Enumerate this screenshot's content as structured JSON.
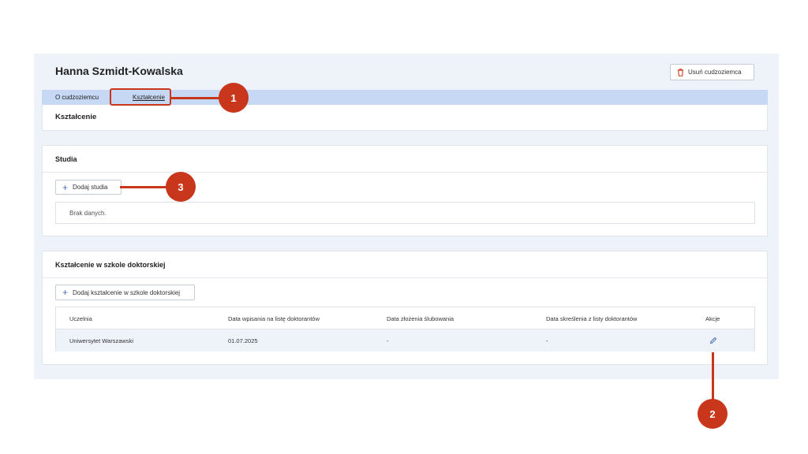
{
  "header": {
    "title": "Hanna Szmidt-Kowalska",
    "delete_button": "Usuń cudzoziemca"
  },
  "tabs": [
    {
      "label": "O cudzoziemcu"
    },
    {
      "label": "Kształcenie"
    }
  ],
  "section_title": "Kształcenie",
  "studia": {
    "title": "Studia",
    "add_button": "Dodaj studia",
    "empty_text": "Brak danych."
  },
  "doctoral": {
    "title": "Kształcenie w szkole doktorskiej",
    "add_button": "Dodaj kształcenie w szkole doktorskiej",
    "columns": [
      "Uczelnia",
      "Data wpisania na listę doktorantów",
      "Data złożenia ślubowania",
      "Data skreślenia z listy doktorantów",
      "Akcje"
    ],
    "rows": [
      [
        "Uniwersytet Warszawski",
        "01.07.2025",
        "-",
        "-"
      ]
    ]
  },
  "callouts": [
    "1",
    "2",
    "3"
  ],
  "colors": {
    "accent": "#c8361b",
    "tabbar": "#c7d8f4",
    "background": "#eef2f9",
    "icon": "#4b6fb5"
  },
  "icons": {
    "delete": "trash-icon",
    "add": "plus-icon",
    "edit": "pencil-icon"
  }
}
